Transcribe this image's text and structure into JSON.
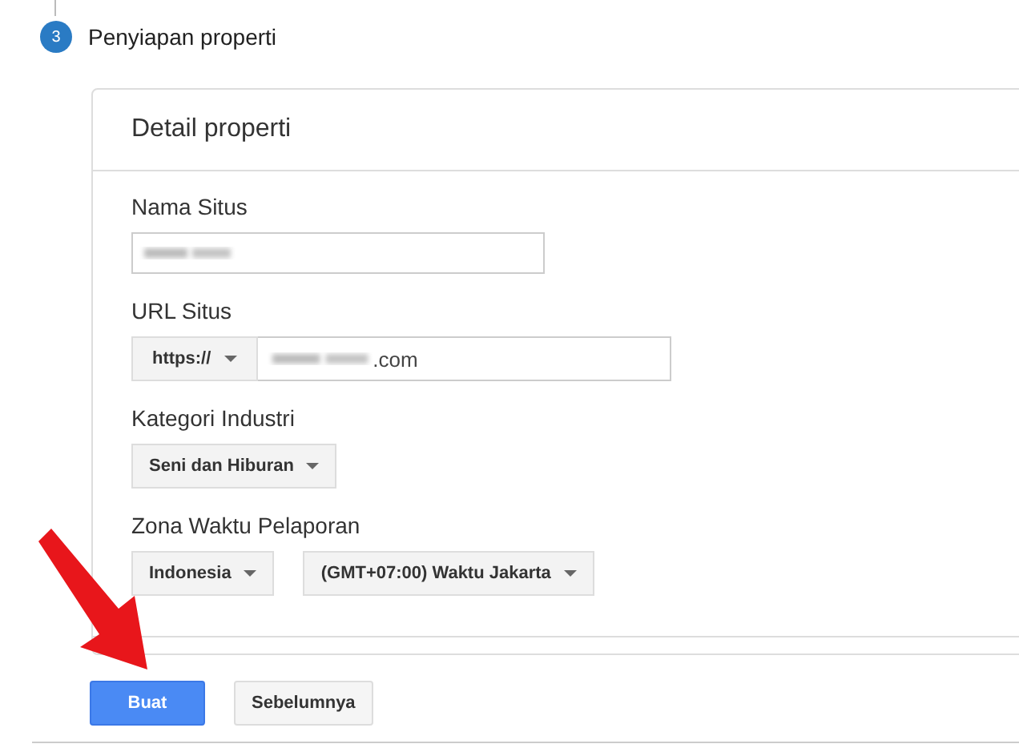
{
  "step": {
    "number": "3",
    "title": "Penyiapan properti"
  },
  "card": {
    "title": "Detail properti",
    "fields": [
      {
        "kind": "text",
        "label": "Nama Situs"
      },
      {
        "kind": "url",
        "label": "URL Situs",
        "protocol": "https://",
        "value": ".com"
      },
      {
        "kind": "select",
        "label": "Kategori Industri",
        "options": [
          "Seni dan Hiburan"
        ]
      },
      {
        "kind": "select",
        "label": "Zona Waktu Pelaporan",
        "options": [
          "Indonesia",
          "(GMT+07:00) Waktu Jakarta"
        ]
      }
    ]
  },
  "buttons": [
    {
      "label": "Buat",
      "kind": "primary"
    },
    {
      "label": "Sebelumnya",
      "kind": "secondary"
    }
  ]
}
